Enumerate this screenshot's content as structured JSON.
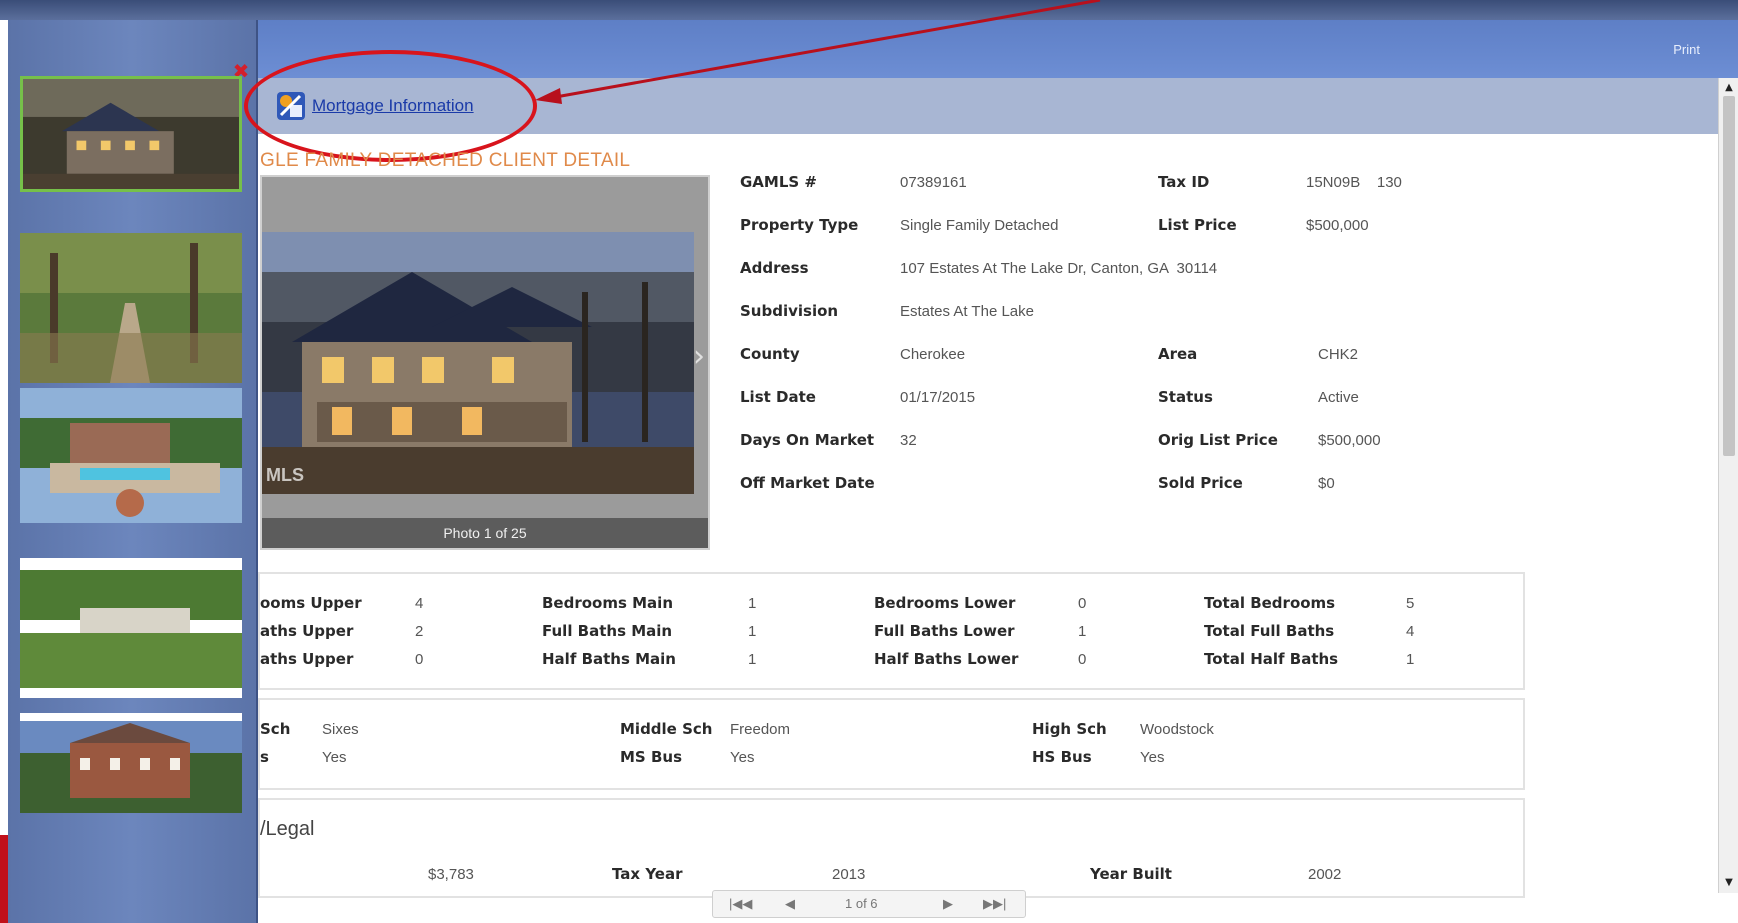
{
  "header": {
    "print_label": "Print"
  },
  "sub_header": {
    "mortgage_link": "Mortgage Information",
    "icon": "calculator-tools-icon"
  },
  "thumb_panel": {
    "close_icon": "close-icon",
    "close_glyph": "✖"
  },
  "detail_title": "GLE FAMILY DETACHED CLIENT DETAIL",
  "photo": {
    "caption": "Photo 1 of 25",
    "watermark": "MLS"
  },
  "info": {
    "gamls_label": "GAMLS #",
    "gamls_value": "07389161",
    "taxid_label": "Tax ID",
    "taxid_value": "15N09B    130",
    "proptype_label": "Property Type",
    "proptype_value": "Single Family Detached",
    "listprice_label": "List Price",
    "listprice_value": "$500,000",
    "address_label": "Address",
    "address_value": "107 Estates At The Lake Dr, Canton, GA  30114",
    "subdivision_label": "Subdivision",
    "subdivision_value": "Estates At The Lake",
    "county_label": "County",
    "county_value": "Cherokee",
    "area_label": "Area",
    "area_value": "CHK2",
    "listdate_label": "List Date",
    "listdate_value": "01/17/2015",
    "status_label": "Status",
    "status_value": "Active",
    "dom_label": "Days On Market",
    "dom_value": "32",
    "origprice_label": "Orig List Price",
    "origprice_value": "$500,000",
    "offmarket_label": "Off Market Date",
    "soldprice_label": "Sold Price",
    "soldprice_value": "$0"
  },
  "rooms": {
    "r1": [
      "ooms Upper",
      "4",
      "Bedrooms Main",
      "1",
      "Bedrooms Lower",
      "0",
      "Total Bedrooms",
      "5"
    ],
    "r2": [
      "aths Upper",
      "2",
      "Full Baths Main",
      "1",
      "Full Baths Lower",
      "1",
      "Total Full Baths",
      "4"
    ],
    "r3": [
      "aths Upper",
      "0",
      "Half Baths Main",
      "1",
      "Half Baths Lower",
      "0",
      "Total Half Baths",
      "1"
    ]
  },
  "schools": {
    "r1": [
      "Sch",
      "Sixes",
      "Middle Sch",
      "Freedom",
      "High Sch",
      "Woodstock"
    ],
    "r2": [
      "s",
      "Yes",
      "MS Bus",
      "Yes",
      "HS Bus",
      "Yes"
    ]
  },
  "legal": {
    "title": "/Legal",
    "tax_amount": "$3,783",
    "taxyear_label": "Tax Year",
    "taxyear_value": "2013",
    "yearbuilt_label": "Year Built",
    "yearbuilt_value": "2002"
  },
  "pager": {
    "first": "|◀◀",
    "prev": "◀",
    "page_text": "1 of 6",
    "next": "▶",
    "last": "▶▶|"
  },
  "colors": {
    "accent_header": "#5e7fc6",
    "highlight_red": "#d8141c",
    "active_thumb_border": "#76c04a",
    "title_orange": "#e08a4a"
  }
}
